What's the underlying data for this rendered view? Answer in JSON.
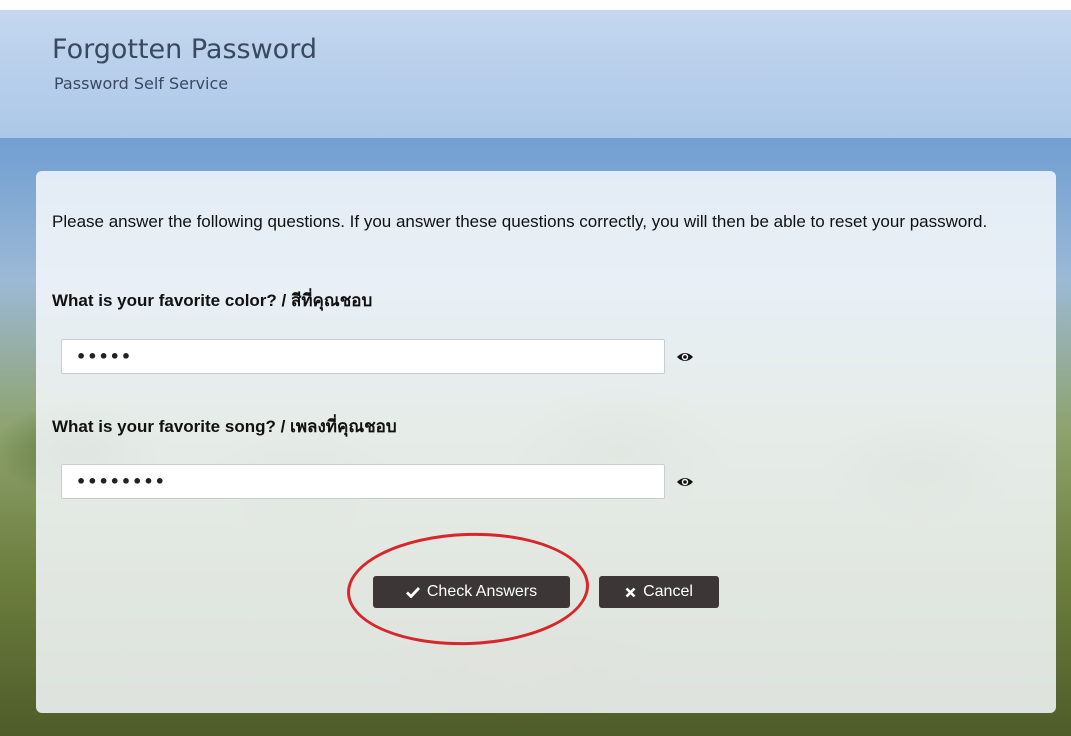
{
  "header": {
    "title": "Forgotten Password",
    "subtitle": "Password Self Service"
  },
  "form": {
    "instructions": "Please answer the following questions. If you answer these questions correctly, you will then be able to reset your password.",
    "questions": [
      {
        "label": "What is your favorite color? / สีที่คุณชอบ",
        "value": "•••••"
      },
      {
        "label": "What is your favorite song? / เพลงที่คุณชอบ",
        "value": "••••••••"
      }
    ]
  },
  "buttons": {
    "check_answers": "Check Answers",
    "cancel": "Cancel"
  },
  "icons": {
    "check": "check-icon",
    "cancel": "x-icon",
    "show_password": "eye-icon"
  },
  "colors": {
    "button_bg": "#3c3637",
    "annotation_circle": "#d8262a"
  }
}
